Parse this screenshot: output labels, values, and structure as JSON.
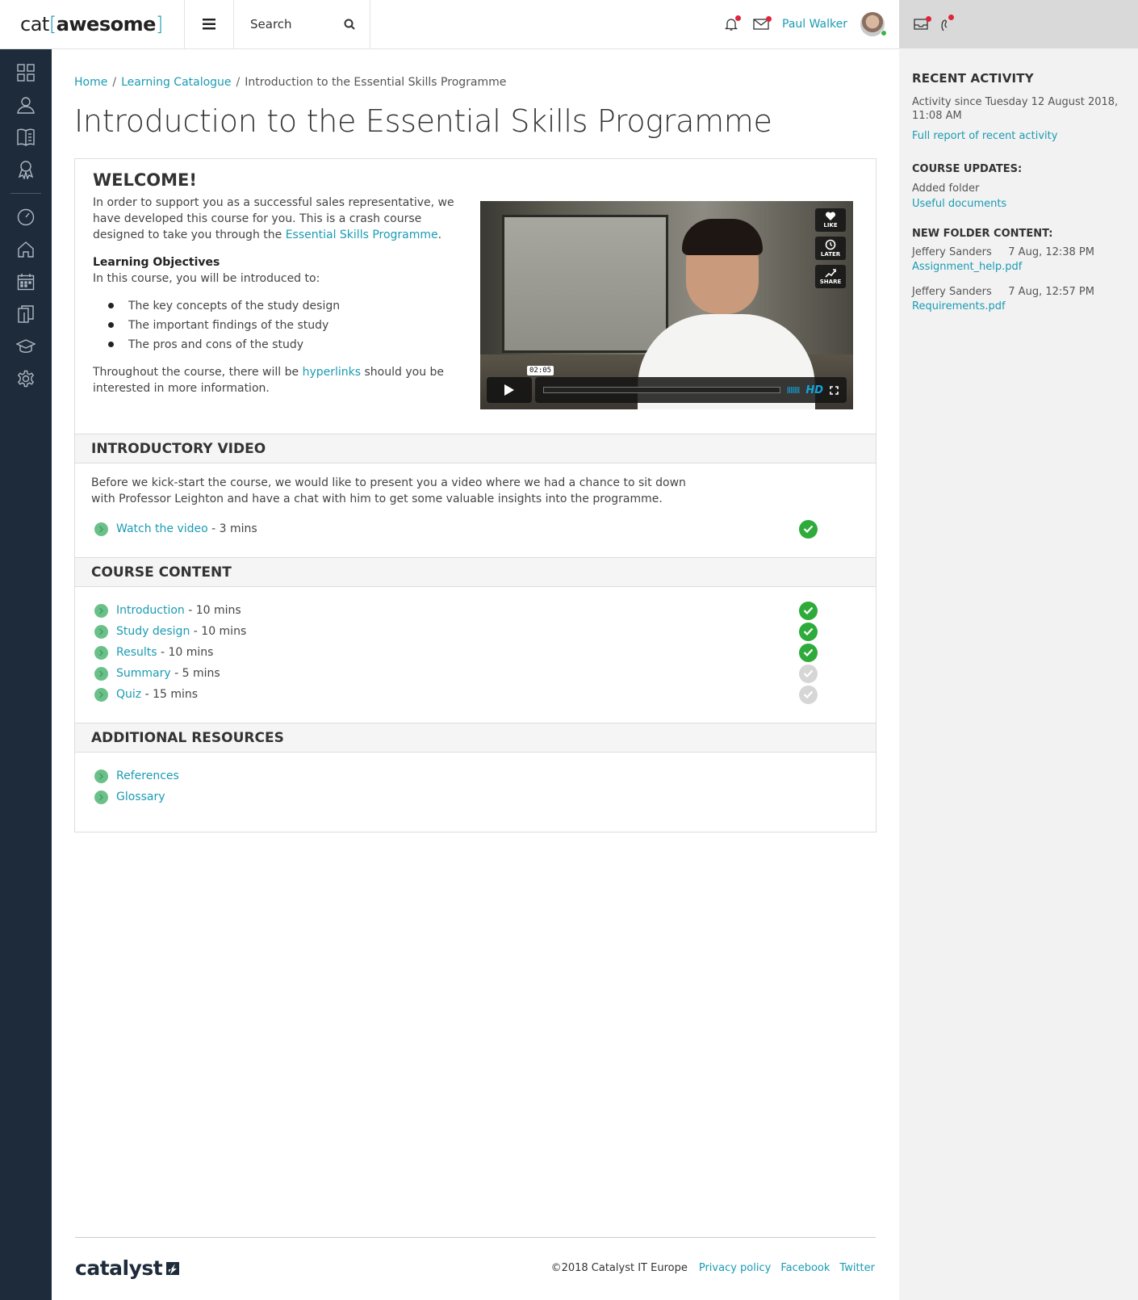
{
  "header": {
    "logo_prefix": "cat",
    "logo_bracket_open": "[",
    "logo_main": "awesome",
    "logo_bracket_close": "]",
    "search_placeholder": "Search",
    "user_name": "Paul Walker"
  },
  "sidebar": {
    "icons": [
      "dashboard-icon",
      "users-icon",
      "catalogue-icon",
      "badge-icon",
      "gauge-icon",
      "home-icon",
      "calendar-icon",
      "documents-icon",
      "graduation-cap-icon",
      "settings-icon"
    ]
  },
  "breadcrumb": {
    "home": "Home",
    "catalogue": "Learning Catalogue",
    "current": "Introduction to the Essential Skills Programme",
    "separator": "/"
  },
  "page_title": "Introduction to the Essential Skills Programme",
  "welcome": {
    "heading": "WELCOME!",
    "intro_text": "In order to support you as a successful sales representative, we have developed this course for you. This is a crash course designed to take you through the ",
    "intro_link": "Essential Skills Programme",
    "intro_end": ".",
    "objectives_heading": "Learning Objectives",
    "objectives_intro": "In this course, you will be introduced to:",
    "objectives": [
      "The key concepts of the study design",
      "The important findings of the study",
      "The pros and cons of the study"
    ],
    "outro_text": "Throughout the course, there will be ",
    "outro_link": "hyperlinks",
    "outro_end": " should you be interested in more information."
  },
  "video": {
    "like": "LIKE",
    "later": "LATER",
    "share": "SHARE",
    "time": "02:05",
    "hd": "HD",
    "volume": "IIIIIII"
  },
  "intro_video": {
    "heading": "INTRODUCTORY VIDEO",
    "text": "Before we kick-start the course, we would like to present you a video where we had a chance to sit down with Professor Leighton and have a chat with him to get some valuable insights into the programme.",
    "item_link": "Watch the video",
    "item_duration": " - 3 mins",
    "item_done": true
  },
  "course_content": {
    "heading": "COURSE CONTENT",
    "items": [
      {
        "title": "Introduction",
        "duration": " - 10 mins",
        "done": true
      },
      {
        "title": "Study design",
        "duration": " - 10 mins",
        "done": true
      },
      {
        "title": "Results",
        "duration": " - 10 mins",
        "done": true
      },
      {
        "title": "Summary",
        "duration": " - 5 mins",
        "done": false
      },
      {
        "title": "Quiz",
        "duration": " - 15 mins",
        "done": false
      }
    ]
  },
  "additional": {
    "heading": "ADDITIONAL RESOURCES",
    "items": [
      "References",
      "Glossary"
    ]
  },
  "right_panel": {
    "recent_heading": "RECENT ACTIVITY",
    "activity_since": "Activity since Tuesday 12 August 2018, 11:08 AM",
    "full_report": "Full report of recent activity",
    "updates_heading": "COURSE UPDATES:",
    "updates_text": "Added folder",
    "updates_link": "Useful documents",
    "folder_heading": "NEW FOLDER CONTENT:",
    "folder_items": [
      {
        "user": "Jeffery Sanders",
        "time": "7 Aug, 12:38 PM",
        "file": "Assignment_help.pdf"
      },
      {
        "user": "Jeffery Sanders",
        "time": "7 Aug, 12:57 PM",
        "file": "Requirements.pdf"
      }
    ]
  },
  "footer": {
    "logo": "catalyst",
    "copyright": "©2018 Catalyst IT Europe",
    "privacy": "Privacy policy",
    "facebook": "Facebook",
    "twitter": "Twitter"
  },
  "colors": {
    "accent": "#1a9bb3",
    "sidebar": "#1e2b3b",
    "done": "#2eab3a",
    "todo": "#d6d6d6",
    "notification": "#e0253a"
  }
}
